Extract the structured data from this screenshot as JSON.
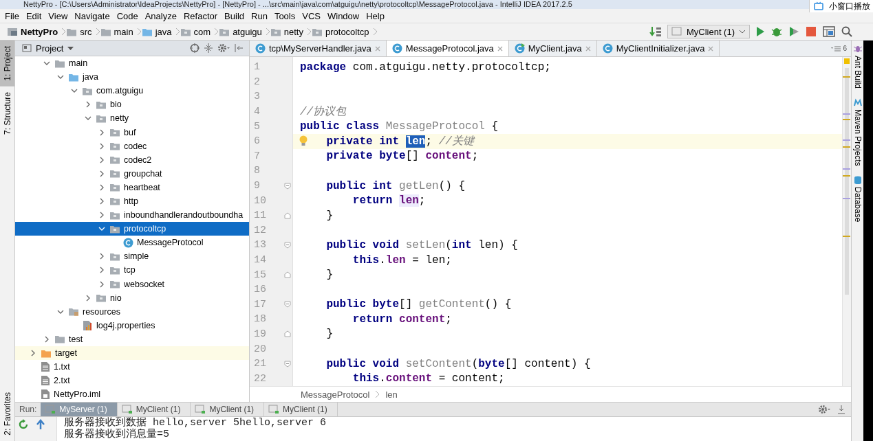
{
  "window": {
    "title": "NettyPro - [C:\\Users\\Administrator\\IdeaProjects\\NettyPro] - [NettyPro] - ...\\src\\main\\java\\com\\atguigu\\netty\\protocoltcp\\MessageProtocol.java - IntelliJ IDEA 2017.2.5"
  },
  "popup": {
    "label": "小窗口播放"
  },
  "menu": [
    "File",
    "Edit",
    "View",
    "Navigate",
    "Code",
    "Analyze",
    "Refactor",
    "Build",
    "Run",
    "Tools",
    "VCS",
    "Window",
    "Help"
  ],
  "navbar": {
    "crumbs": [
      {
        "label": "NettyPro",
        "kind": "module"
      },
      {
        "label": "src",
        "kind": "folder"
      },
      {
        "label": "main",
        "kind": "folder"
      },
      {
        "label": "java",
        "kind": "source"
      },
      {
        "label": "com",
        "kind": "package"
      },
      {
        "label": "atguigu",
        "kind": "package"
      },
      {
        "label": "netty",
        "kind": "package"
      },
      {
        "label": "protocoltcp",
        "kind": "package"
      }
    ],
    "run_config": "MyClient (1)"
  },
  "left_strip": [
    {
      "label": "1: Project",
      "selected": true
    },
    {
      "label": "7: Structure",
      "selected": false
    }
  ],
  "left_strip_bottom": [
    {
      "label": "2: Favorites",
      "selected": false
    }
  ],
  "right_strip": [
    {
      "label": "Ant Build",
      "kind": "ant"
    },
    {
      "label": "Maven Projects",
      "kind": "maven"
    },
    {
      "label": "Database",
      "kind": "database"
    }
  ],
  "project": {
    "title": "Project",
    "tree": [
      {
        "children": [
          {
            "label": "main",
            "kind": "folder",
            "expanded": true,
            "selected": false,
            "children": [
              {
                "label": "java",
                "kind": "source",
                "expanded": true,
                "selected": false,
                "children": [
                  {
                    "label": "com.atguigu",
                    "kind": "package",
                    "expanded": true,
                    "selected": false,
                    "children": [
                      {
                        "label": "bio",
                        "kind": "package",
                        "expanded": false,
                        "selected": false
                      },
                      {
                        "label": "netty",
                        "kind": "package",
                        "expanded": true,
                        "selected": false,
                        "children": [
                          {
                            "label": "buf",
                            "kind": "package",
                            "expanded": false,
                            "selected": false
                          },
                          {
                            "label": "codec",
                            "kind": "package",
                            "expanded": false,
                            "selected": false
                          },
                          {
                            "label": "codec2",
                            "kind": "package",
                            "expanded": false,
                            "selected": false
                          },
                          {
                            "label": "groupchat",
                            "kind": "package",
                            "expanded": false,
                            "selected": false
                          },
                          {
                            "label": "heartbeat",
                            "kind": "package",
                            "expanded": false,
                            "selected": false
                          },
                          {
                            "label": "http",
                            "kind": "package",
                            "expanded": false,
                            "selected": false
                          },
                          {
                            "label": "inboundhandlerandoutboundha",
                            "kind": "package",
                            "expanded": false,
                            "selected": false
                          },
                          {
                            "label": "protocoltcp",
                            "kind": "package",
                            "expanded": true,
                            "selected": true,
                            "children": [
                              {
                                "label": "MessageProtocol",
                                "kind": "class",
                                "selected": false
                              }
                            ]
                          },
                          {
                            "label": "simple",
                            "kind": "package",
                            "expanded": false,
                            "selected": false
                          },
                          {
                            "label": "tcp",
                            "kind": "package",
                            "expanded": false,
                            "selected": false
                          },
                          {
                            "label": "websocket",
                            "kind": "package",
                            "expanded": false,
                            "selected": false
                          }
                        ]
                      },
                      {
                        "label": "nio",
                        "kind": "package",
                        "expanded": false,
                        "selected": false
                      }
                    ]
                  }
                ]
              },
              {
                "label": "resources",
                "kind": "resources",
                "expanded": true,
                "selected": false,
                "children": [
                  {
                    "label": "log4j.properties",
                    "kind": "properties",
                    "selected": false
                  }
                ]
              }
            ]
          },
          {
            "label": "test",
            "kind": "folder",
            "expanded": false,
            "selected": false
          }
        ]
      },
      {
        "label": "target",
        "kind": "excluded",
        "expanded": false,
        "selected": false
      },
      {
        "label": "1.txt",
        "kind": "text",
        "selected": false
      },
      {
        "label": "2.txt",
        "kind": "text",
        "selected": false
      },
      {
        "label": "NettyPro.iml",
        "kind": "module-file",
        "selected": false
      }
    ]
  },
  "editor": {
    "tabs": [
      {
        "label": "tcp\\MyServerHandler.java",
        "kind": "class",
        "selected": false
      },
      {
        "label": "MessageProtocol.java",
        "kind": "class",
        "selected": true
      },
      {
        "label": "MyClient.java",
        "kind": "runnable",
        "selected": false
      },
      {
        "label": "MyClientInitializer.java",
        "kind": "class",
        "selected": false
      }
    ],
    "hidden_tabs": "6",
    "lines": [
      {
        "number": "1",
        "tokens": [
          {
            "t": "package",
            "kind": "keyword"
          },
          {
            "t": " com.atguigu.netty.protocoltcp;",
            "kind": "plain"
          }
        ]
      },
      {
        "number": "2"
      },
      {
        "number": "3"
      },
      {
        "number": "4",
        "tokens": [
          {
            "t": "//协议包",
            "kind": "comment"
          }
        ]
      },
      {
        "number": "5",
        "tokens": [
          {
            "t": "public class ",
            "kind": "keyword"
          },
          {
            "t": "MessageProtocol",
            "kind": "unused"
          },
          {
            "t": " {",
            "kind": "plain"
          }
        ]
      },
      {
        "number": "6",
        "current": true,
        "bulb": true,
        "tokens": [
          {
            "t": "    private int ",
            "kind": "keyword"
          },
          {
            "t": "len",
            "kind": "field",
            "selected": true
          },
          {
            "t": "; ",
            "kind": "plain"
          },
          {
            "t": "//关键",
            "kind": "comment"
          }
        ]
      },
      {
        "number": "7",
        "tokens": [
          {
            "t": "    private byte",
            "kind": "keyword"
          },
          {
            "t": "[] ",
            "kind": "plain"
          },
          {
            "t": "content",
            "kind": "field"
          },
          {
            "t": ";",
            "kind": "plain"
          }
        ]
      },
      {
        "number": "8"
      },
      {
        "number": "9",
        "fold_start": true,
        "tokens": [
          {
            "t": "    public int ",
            "kind": "keyword"
          },
          {
            "t": "getLen",
            "kind": "unused"
          },
          {
            "t": "() {",
            "kind": "plain"
          }
        ]
      },
      {
        "number": "10",
        "tokens": [
          {
            "t": "        return ",
            "kind": "keyword"
          },
          {
            "t": "len",
            "kind": "field",
            "usage_highlight": true
          },
          {
            "t": ";",
            "kind": "plain"
          }
        ]
      },
      {
        "number": "11",
        "fold_end": true,
        "tokens": [
          {
            "t": "    }",
            "kind": "plain"
          }
        ]
      },
      {
        "number": "12"
      },
      {
        "number": "13",
        "fold_start": true,
        "tokens": [
          {
            "t": "    public void ",
            "kind": "keyword"
          },
          {
            "t": "setLen",
            "kind": "unused"
          },
          {
            "t": "(",
            "kind": "plain"
          },
          {
            "t": "int ",
            "kind": "keyword"
          },
          {
            "t": "len) {",
            "kind": "plain"
          }
        ]
      },
      {
        "number": "14",
        "tokens": [
          {
            "t": "        this",
            "kind": "keyword"
          },
          {
            "t": ".",
            "kind": "plain"
          },
          {
            "t": "len",
            "kind": "field"
          },
          {
            "t": " = len;",
            "kind": "plain"
          }
        ]
      },
      {
        "number": "15",
        "fold_end": true,
        "tokens": [
          {
            "t": "    }",
            "kind": "plain"
          }
        ]
      },
      {
        "number": "16"
      },
      {
        "number": "17",
        "fold_start": true,
        "tokens": [
          {
            "t": "    public byte",
            "kind": "keyword"
          },
          {
            "t": "[] ",
            "kind": "plain"
          },
          {
            "t": "getContent",
            "kind": "unused"
          },
          {
            "t": "() {",
            "kind": "plain"
          }
        ]
      },
      {
        "number": "18",
        "tokens": [
          {
            "t": "        return ",
            "kind": "keyword"
          },
          {
            "t": "content",
            "kind": "field"
          },
          {
            "t": ";",
            "kind": "plain"
          }
        ]
      },
      {
        "number": "19",
        "fold_end": true,
        "tokens": [
          {
            "t": "    }",
            "kind": "plain"
          }
        ]
      },
      {
        "number": "20"
      },
      {
        "number": "21",
        "fold_start": true,
        "tokens": [
          {
            "t": "    public void ",
            "kind": "keyword"
          },
          {
            "t": "setContent",
            "kind": "unused"
          },
          {
            "t": "(",
            "kind": "plain"
          },
          {
            "t": "byte",
            "kind": "keyword"
          },
          {
            "t": "[] content) {",
            "kind": "plain"
          }
        ]
      },
      {
        "number": "22",
        "tokens": [
          {
            "t": "        this",
            "kind": "keyword"
          },
          {
            "t": ".",
            "kind": "plain"
          },
          {
            "t": "content",
            "kind": "field"
          },
          {
            "t": " = content;",
            "kind": "plain"
          }
        ]
      }
    ],
    "breadcrumb": [
      "MessageProtocol",
      "len"
    ]
  },
  "run": {
    "label": "Run:",
    "tabs": [
      {
        "label": "MyServer (1)",
        "selected": true
      },
      {
        "label": "MyClient (1)",
        "selected": false
      },
      {
        "label": "MyClient (1)",
        "selected": false
      },
      {
        "label": "MyClient (1)",
        "selected": false
      }
    ],
    "console": [
      "服务器接收到数据 hello,server 5hello,server 6",
      "服务器接收到消息量=5"
    ]
  }
}
